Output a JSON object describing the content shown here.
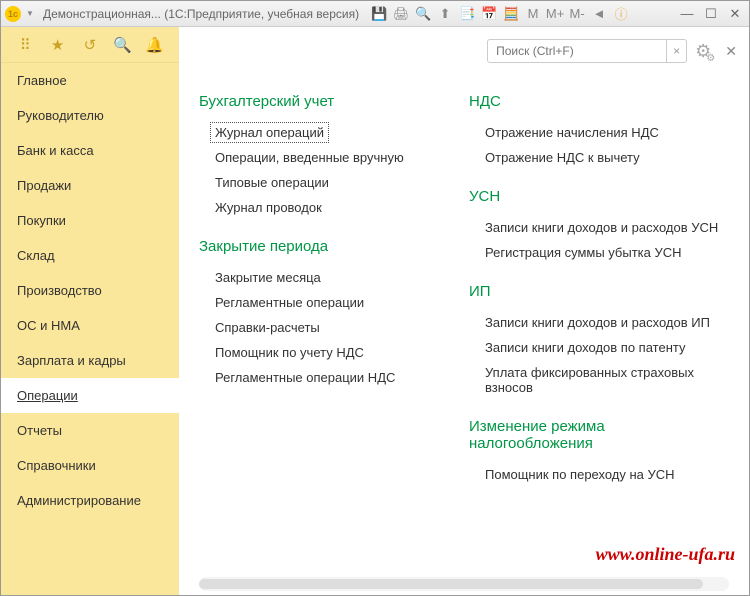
{
  "titlebar": {
    "title": "Демонстрационная...  (1С:Предприятие, учебная версия)",
    "memory_labels": [
      "M",
      "M+",
      "M-"
    ]
  },
  "sidebar": {
    "items": [
      {
        "label": "Главное"
      },
      {
        "label": "Руководителю"
      },
      {
        "label": "Банк и касса"
      },
      {
        "label": "Продажи"
      },
      {
        "label": "Покупки"
      },
      {
        "label": "Склад"
      },
      {
        "label": "Производство"
      },
      {
        "label": "ОС и НМА"
      },
      {
        "label": "Зарплата и кадры"
      },
      {
        "label": "Операции",
        "active": true
      },
      {
        "label": "Отчеты"
      },
      {
        "label": "Справочники"
      },
      {
        "label": "Администрирование"
      }
    ]
  },
  "search": {
    "placeholder": "Поиск (Ctrl+F)"
  },
  "sections_left": [
    {
      "title": "Бухгалтерский учет",
      "items": [
        {
          "label": "Журнал операций",
          "focused": true
        },
        {
          "label": "Операции, введенные вручную"
        },
        {
          "label": "Типовые операции"
        },
        {
          "label": "Журнал проводок"
        }
      ]
    },
    {
      "title": "Закрытие периода",
      "items": [
        {
          "label": "Закрытие месяца"
        },
        {
          "label": "Регламентные операции"
        },
        {
          "label": "Справки-расчеты"
        },
        {
          "label": "Помощник по учету НДС"
        },
        {
          "label": "Регламентные операции НДС"
        }
      ]
    }
  ],
  "sections_right": [
    {
      "title": "НДС",
      "items": [
        {
          "label": "Отражение начисления НДС"
        },
        {
          "label": "Отражение НДС к вычету"
        }
      ]
    },
    {
      "title": "УСН",
      "items": [
        {
          "label": "Записи книги доходов и расходов УСН"
        },
        {
          "label": "Регистрация суммы убытка УСН"
        }
      ]
    },
    {
      "title": "ИП",
      "items": [
        {
          "label": "Записи книги доходов и расходов ИП"
        },
        {
          "label": "Записи книги доходов по патенту"
        },
        {
          "label": "Уплата фиксированных страховых взносов"
        }
      ]
    },
    {
      "title": "Изменение режима налогообложения",
      "items": [
        {
          "label": "Помощник по переходу на УСН"
        }
      ]
    }
  ],
  "watermark": "www.online-ufa.ru"
}
